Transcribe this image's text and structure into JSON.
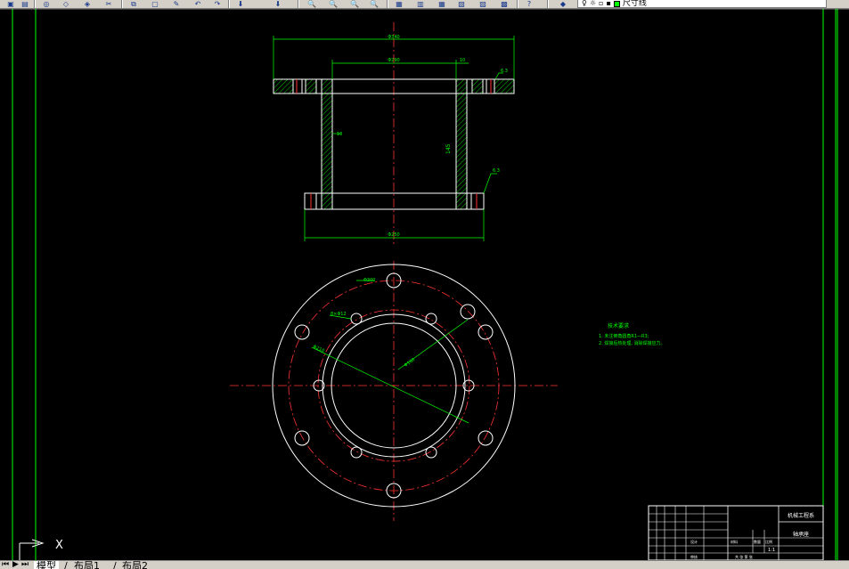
{
  "toolbar": {
    "icons": [
      "save-icon",
      "print-icon",
      "preview-icon",
      "plot-icon",
      "publish-icon",
      "cut-icon",
      "copy-icon",
      "paste-icon",
      "match-icon",
      "undo-icon",
      "redo-icon",
      "pan-icon",
      "zoom-realtime-icon",
      "zoom-window-icon",
      "zoom-previous-icon",
      "properties-icon",
      "design-center-icon",
      "tool-palette-icon",
      "sheet-set-icon",
      "markup-icon",
      "calc-icon",
      "help-icon",
      "layer-manager-icon",
      "layer-state-icon",
      "layer-previous-icon"
    ],
    "layer_value": "尺寸线",
    "layer_color": "#00ff00"
  },
  "drawing": {
    "dims": {
      "top_width": "Φ340",
      "inner_width": "Φ290",
      "right_small": "10",
      "height_label": "145",
      "wall_label": "10",
      "bottom_width": "Φ250",
      "rough_top": "6.3",
      "rough_bottom": "6.3",
      "pcd_outer": "Φ300",
      "pcd_inner": "Φ210",
      "hole_label": "8×Φ12",
      "bore_label": "Φ160"
    },
    "notes": {
      "title": "技术要求",
      "line1": "1. 未注倒角圆角R1—R3;",
      "line2": "2. 焊接后热处理, 消除焊接应力。"
    },
    "title_block": {
      "company": "机械工程系",
      "part_name": "轴承座",
      "scale": "1:1",
      "label_drawing": "设计",
      "label_check": "审核",
      "label_mat": "材料",
      "label_qty": "数量",
      "label_weight": "重量",
      "label_ratio": "比例",
      "label_sheets": "共 张 第 张"
    }
  },
  "tabs": {
    "model": "模型",
    "layout1": "布局1",
    "layout2": "布局2"
  },
  "ucs": {
    "x_label": "X"
  }
}
